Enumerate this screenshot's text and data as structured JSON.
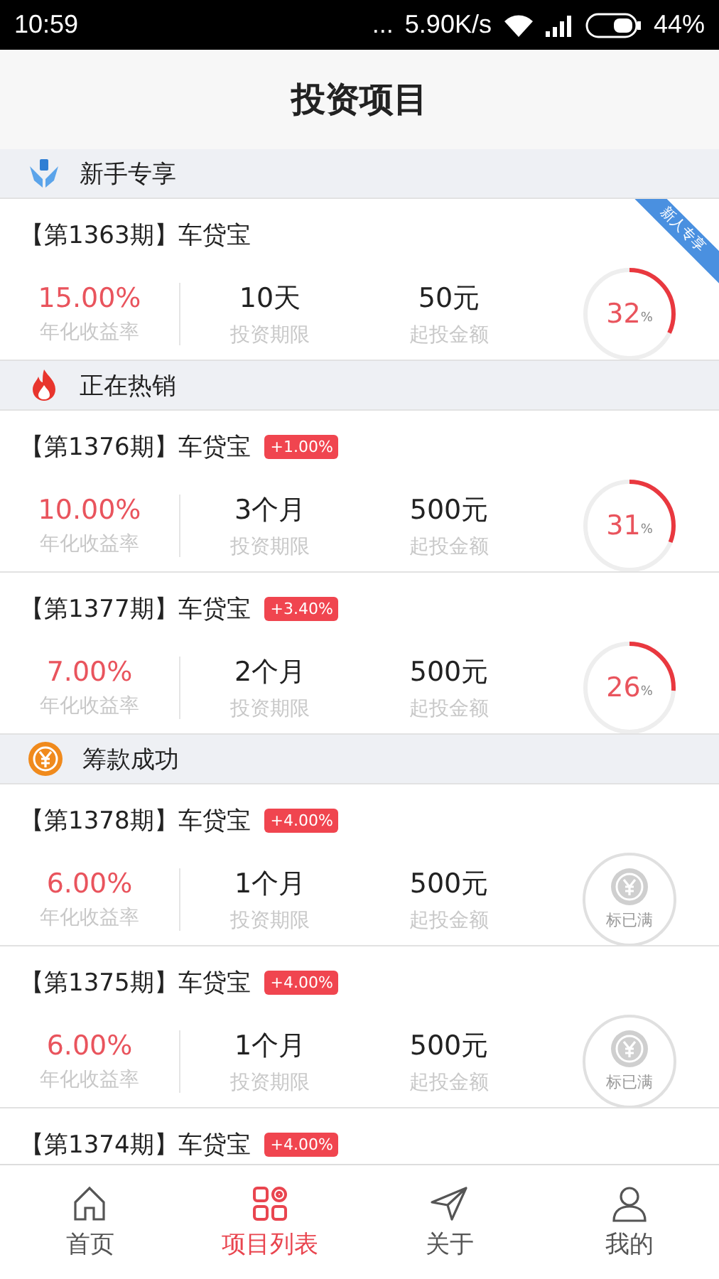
{
  "status_bar": {
    "time": "10:59",
    "dots": "...",
    "speed": "5.90K/s",
    "battery": "44%"
  },
  "header": {
    "title": "投资项目"
  },
  "sections": [
    {
      "kind": "newbie",
      "title": "新手专享",
      "cards": [
        {
          "title": "【第1363期】车贷宝",
          "ribbon": "新人专享",
          "rate": "15.00%",
          "rate_label": "年化收益率",
          "term": "10天",
          "term_label": "投资期限",
          "min": "50元",
          "min_label": "起投金额",
          "kind": "progress",
          "level": 0.32,
          "percent": "32",
          "unit": "%"
        }
      ]
    },
    {
      "kind": "hot",
      "title": "正在热销",
      "cards": [
        {
          "title": "【第1376期】车贷宝",
          "bonus": "+1.00%",
          "rate": "10.00%",
          "rate_label": "年化收益率",
          "term": "3个月",
          "term_label": "投资期限",
          "min": "500元",
          "min_label": "起投金额",
          "kind": "progress",
          "level": 0.31,
          "percent": "31",
          "unit": "%"
        },
        {
          "title": "【第1377期】车贷宝",
          "bonus": "+3.40%",
          "rate": "7.00%",
          "rate_label": "年化收益率",
          "term": "2个月",
          "term_label": "投资期限",
          "min": "500元",
          "min_label": "起投金额",
          "kind": "progress",
          "level": 0.26,
          "percent": "26",
          "unit": "%"
        }
      ]
    },
    {
      "kind": "done",
      "title": "筹款成功",
      "cards": [
        {
          "title": "【第1378期】车贷宝",
          "bonus": "+4.00%",
          "rate": "6.00%",
          "rate_label": "年化收益率",
          "term": "1个月",
          "term_label": "投资期限",
          "min": "500元",
          "min_label": "起投金额",
          "kind": "full",
          "full_label": "标已满"
        },
        {
          "title": "【第1375期】车贷宝",
          "bonus": "+4.00%",
          "rate": "6.00%",
          "rate_label": "年化收益率",
          "term": "1个月",
          "term_label": "投资期限",
          "min": "500元",
          "min_label": "起投金额",
          "kind": "full",
          "full_label": "标已满"
        },
        {
          "title": "【第1374期】车贷宝",
          "bonus": "+4.00%"
        }
      ]
    }
  ],
  "tabs": [
    {
      "kind": "home",
      "label": "首页",
      "selected": false
    },
    {
      "kind": "list",
      "label": "项目列表",
      "selected": true
    },
    {
      "kind": "about",
      "label": "关于",
      "selected": false
    },
    {
      "kind": "me",
      "label": "我的",
      "selected": false
    }
  ]
}
